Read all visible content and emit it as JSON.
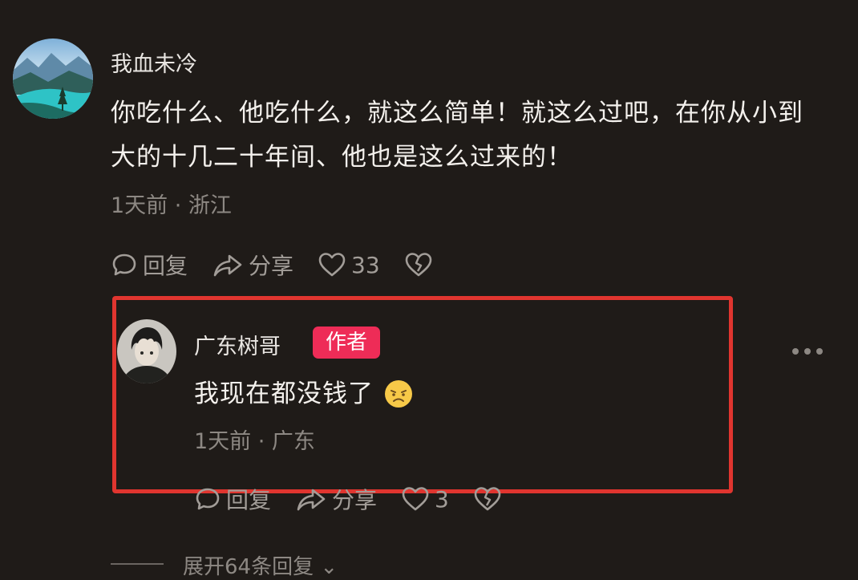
{
  "comment": {
    "username": "我血未冷",
    "text": "你吃什么、他吃什么，就这么简单！就这么过吧，在你从小到大的十几二十年间、他也是这么过来的！",
    "meta": "1天前 · 浙江",
    "actions": {
      "reply_label": "回复",
      "share_label": "分享",
      "like_count": "33"
    }
  },
  "reply": {
    "username": "广东树哥",
    "badge": "作者",
    "text": "我现在都没钱了",
    "emoji": "frowning-face-emoji",
    "meta": "1天前 · 广东",
    "actions": {
      "reply_label": "回复",
      "share_label": "分享",
      "like_count": "3"
    }
  },
  "expand": {
    "label": "展开64条回复"
  },
  "colors": {
    "background": "#1f1b18",
    "highlight_border": "#e0352f",
    "author_badge": "#ee2c57",
    "meta_text": "#8d8883"
  },
  "icons": {
    "reply": "comment-bubble-icon",
    "share": "share-arrow-icon",
    "like": "heart-icon",
    "dislike": "broken-heart-icon",
    "more": "more-dots-icon",
    "expand": "chevron-down-icon"
  }
}
